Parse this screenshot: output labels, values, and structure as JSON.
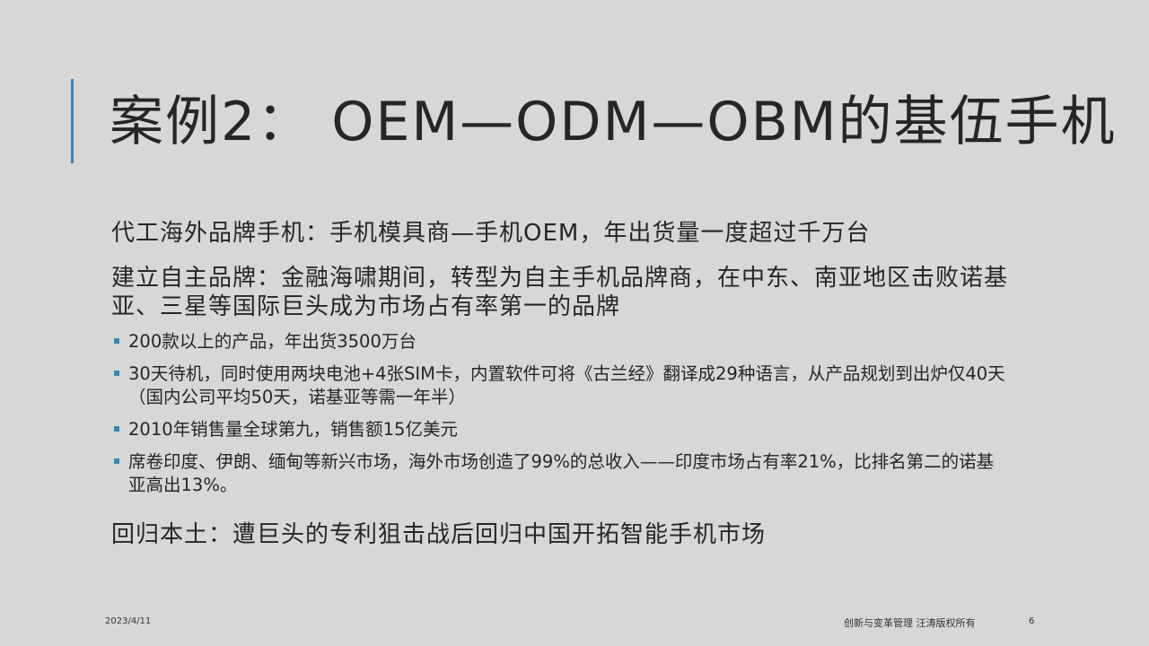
{
  "slide": {
    "title": "案例2： OEM—ODM—OBM的基伍手机",
    "paragraphs": {
      "p1": "代工海外品牌手机：手机模具商—手机OEM，年出货量一度超过千万台",
      "p2": "建立自主品牌：金融海啸期间，转型为自主手机品牌商，在中东、南亚地区击败诺基亚、三星等国际巨头成为市场占有率第一的品牌",
      "p3": "回归本土：遭巨头的专利狙击战后回归中国开拓智能手机市场"
    },
    "bullets": [
      "200款以上的产品，年出货3500万台",
      "30天待机，同时使用两块电池+4张SIM卡，内置软件可将《古兰经》翻译成29种语言，从产品规划到出炉仅40天（国内公司平均50天，诺基亚等需一年半）",
      "2010年销售量全球第九，销售额15亿美元",
      "席卷印度、伊朗、缅甸等新兴市场，海外市场创造了99%的总收入——印度市场占有率21%，比排名第二的诺基亚高出13%。"
    ]
  },
  "footer": {
    "date": "2023/4/11",
    "text": "创新与变革管理 汪涛版权所有",
    "page": "6"
  },
  "colors": {
    "background": "#d7d7d7",
    "accent": "#3a86b5",
    "text": "#262626"
  }
}
